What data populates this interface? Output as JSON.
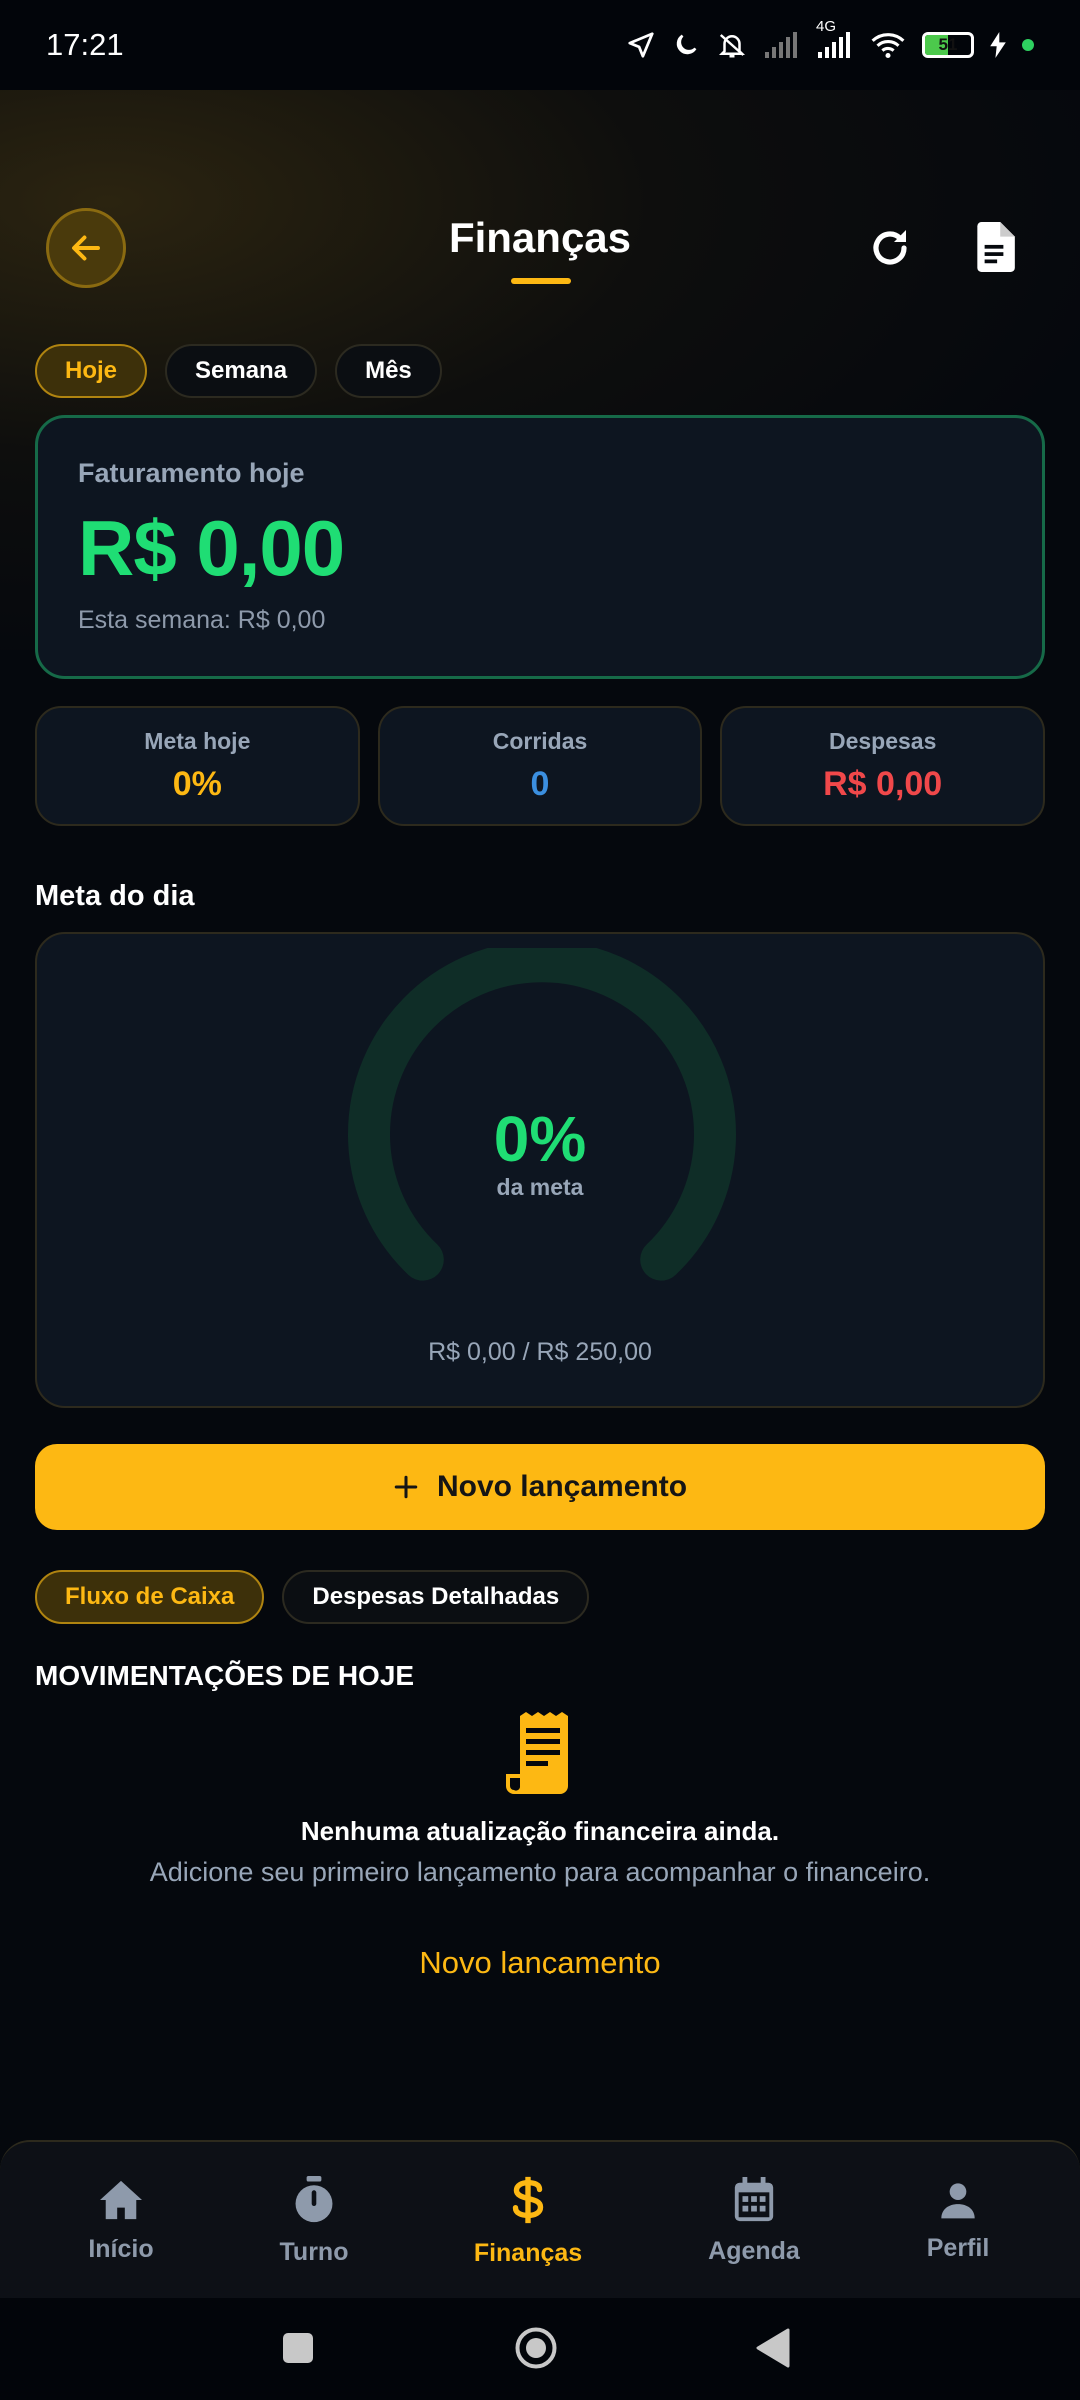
{
  "status_bar": {
    "time": "17:21",
    "network": "4G",
    "battery": "51",
    "icons": [
      "location-icon",
      "moon-icon",
      "bell-off-icon",
      "signal-icon",
      "signal-4g-icon",
      "wifi-icon",
      "battery-icon",
      "charging-icon"
    ]
  },
  "header": {
    "title": "Finanças",
    "back_icon": "arrow-left-icon",
    "refresh_icon": "refresh-icon",
    "report_icon": "document-icon"
  },
  "period_tabs": [
    {
      "label": "Hoje",
      "active": true
    },
    {
      "label": "Semana",
      "active": false
    },
    {
      "label": "Mês",
      "active": false
    }
  ],
  "revenue": {
    "label": "Faturamento hoje",
    "value": "R$ 0,00",
    "week": "Esta semana: R$ 0,00"
  },
  "stats": [
    {
      "label": "Meta hoje",
      "value": "0%",
      "color": "#fdb813"
    },
    {
      "label": "Corridas",
      "value": "0",
      "color": "#3b8fe0"
    },
    {
      "label": "Despesas",
      "value": "R$ 0,00",
      "color": "#f0484a"
    }
  ],
  "goal": {
    "section_title": "Meta do dia",
    "percent": "0%",
    "progress": 0,
    "subtitle": "da meta",
    "amounts": "R$ 0,00 / R$ 250,00"
  },
  "new_entry_button": {
    "label": "Novo lançamento",
    "icon": "plus-icon"
  },
  "view_tabs": [
    {
      "label": "Fluxo de Caixa",
      "active": true
    },
    {
      "label": "Despesas Detalhadas",
      "active": false
    }
  ],
  "movements": {
    "title": "MOVIMENTAÇÕES DE HOJE",
    "empty_icon": "receipt-icon",
    "empty_title": "Nenhuma atualização financeira ainda.",
    "empty_desc": "Adicione seu primeiro lançamento para acompanhar o financeiro.",
    "empty_link": "Novo lançamento"
  },
  "bottom_nav": [
    {
      "label": "Início",
      "icon": "home-icon",
      "active": false
    },
    {
      "label": "Turno",
      "icon": "stopwatch-icon",
      "active": false
    },
    {
      "label": "Finanças",
      "icon": "dollar-icon",
      "active": true
    },
    {
      "label": "Agenda",
      "icon": "calendar-icon",
      "active": false
    },
    {
      "label": "Perfil",
      "icon": "person-icon",
      "active": false
    }
  ],
  "colors": {
    "accent": "#fdb813",
    "positive": "#1fdd74",
    "background": "#05080d",
    "card": "#0d1520"
  }
}
